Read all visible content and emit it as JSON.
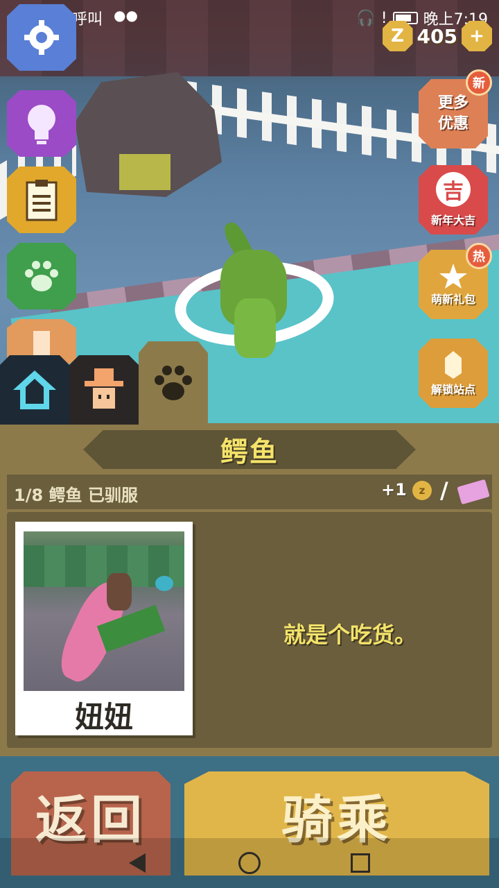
{
  "status_bar": {
    "carrier_text": "仅限紧急呼叫",
    "time": "晚上7:19"
  },
  "currency": {
    "coin_count": "405",
    "coin_icon": "z-coin-icon",
    "add_icon": "plus-icon"
  },
  "left_menu": [
    {
      "icon": "gear-icon"
    },
    {
      "icon": "lightbulb-icon"
    },
    {
      "icon": "clipboard-icon"
    },
    {
      "icon": "paw-icon"
    },
    {
      "icon": "character-icon"
    }
  ],
  "right_menu": {
    "deals": {
      "label": "更多优惠",
      "badge": "新"
    },
    "new_year": {
      "label": "新年大吉",
      "emblem": "吉"
    },
    "gift": {
      "label": "萌新礼包",
      "badge": "热"
    },
    "unlock": {
      "label": "解锁站点"
    }
  },
  "tabs": [
    {
      "icon": "home-icon"
    },
    {
      "icon": "cowboy-icon"
    },
    {
      "icon": "paw-icon",
      "active": true
    }
  ],
  "panel": {
    "title": "鳄鱼",
    "tamed_count": "1/8 鳄鱼 已驯服",
    "reward_bonus": "+1",
    "reward_coin_symbol": "z",
    "separator": "/",
    "pet_name": "妞妞",
    "pet_description": "就是个吃货。"
  },
  "actions": {
    "back_label": "返回",
    "ride_label": "骑乘"
  },
  "colors": {
    "panel": "#8d7a4b",
    "panel_dark": "#6a5e3c",
    "title_yellow": "#f4e36a",
    "back_button": "#b8644c",
    "ride_button": "#e0b64a"
  }
}
